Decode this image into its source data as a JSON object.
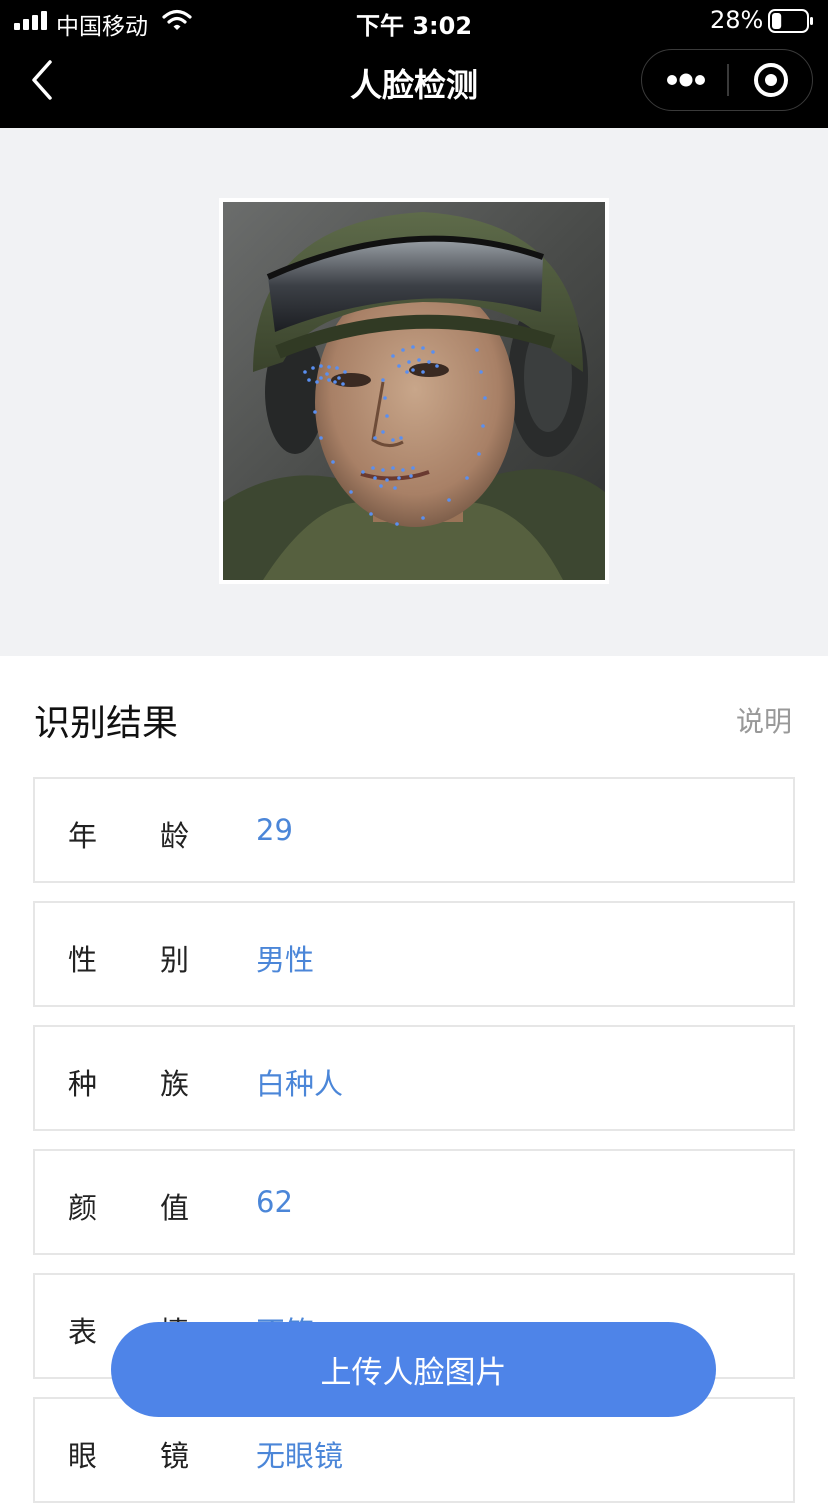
{
  "status_bar": {
    "carrier": "中国移动",
    "time": "下午 3:02",
    "battery_percent": "28%",
    "battery_level": 0.28
  },
  "nav": {
    "title": "人脸检测",
    "back_icon": "chevron-left-icon",
    "more_icon": "more-dots-icon",
    "close_icon": "target-circle-icon"
  },
  "results": {
    "title": "识别结果",
    "help_label": "说明",
    "rows": [
      {
        "k1": "年",
        "k2": "龄",
        "value": "29"
      },
      {
        "k1": "性",
        "k2": "别",
        "value": "男性"
      },
      {
        "k1": "种",
        "k2": "族",
        "value": "白种人"
      },
      {
        "k1": "颜",
        "k2": "值",
        "value": "62"
      },
      {
        "k1": "表",
        "k2": "情",
        "value": "不笑"
      },
      {
        "k1": "眼",
        "k2": "镜",
        "value": "无眼镜"
      }
    ]
  },
  "upload_button": {
    "label": "上传人脸图片"
  },
  "colors": {
    "accent": "#4e84e8",
    "value_text": "#4b86d8",
    "landmark": "#5a8ff0",
    "nav_bg": "#000000",
    "image_bg": "#f1f2f4"
  }
}
